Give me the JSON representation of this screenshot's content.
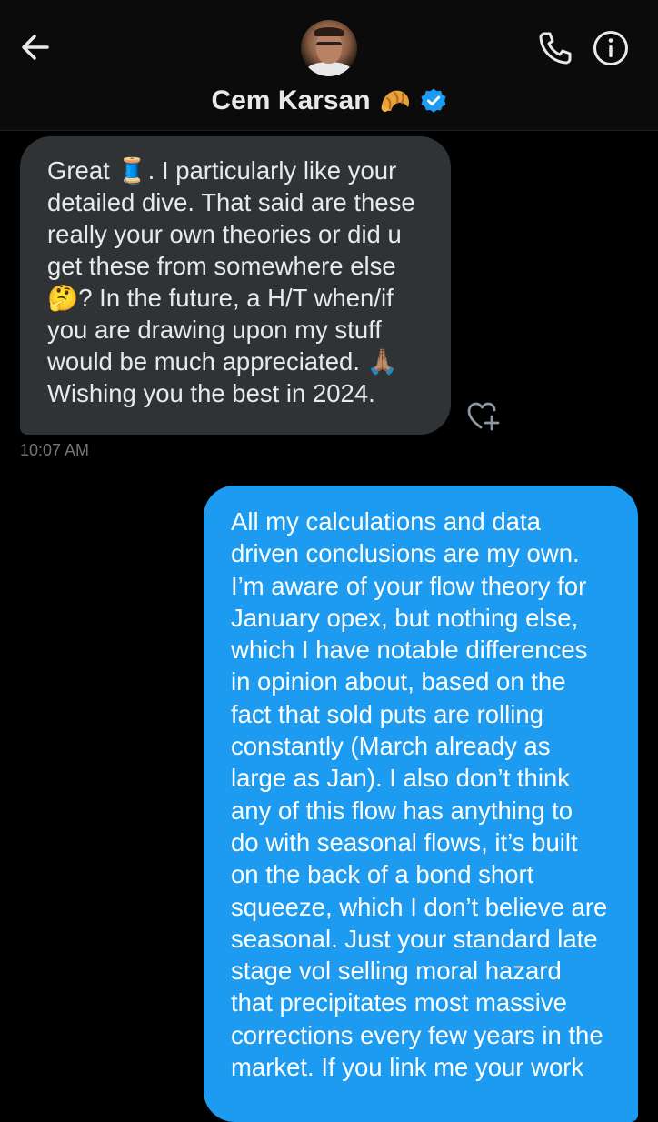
{
  "header": {
    "contact_name": "Cem Karsan",
    "name_emoji_icon": "croissant-icon",
    "verified_icon": "verified-badge-icon",
    "back_icon": "arrow-left-icon",
    "call_icon": "phone-icon",
    "info_icon": "info-icon",
    "accent_color": "#1d9bf0"
  },
  "messages": {
    "incoming": {
      "text": "Great 🧵. I particularly like your\ndetailed dive. That said are these\nreally your own theories or did u\nget these from somewhere else\n🤔? In the future, a  H/T when/if\nyou are drawing upon my stuff\nwould be much appreciated. 🙏🏽\nWishing you the best in 2024.",
      "timestamp": "10:07 AM",
      "bubble_color": "#2f3336",
      "reaction_icon": "add-reaction-heart-icon"
    },
    "outgoing": {
      "text": "All my calculations and data\ndriven conclusions are my own.\nI’m aware of your flow theory for\nJanuary opex, but nothing else,\nwhich I have notable differences\nin opinion about, based on the\nfact that sold puts are rolling\nconstantly (March already as\nlarge as Jan).  I also don’t think\nany of this flow has anything to\ndo with seasonal flows, it’s built\non the back of a bond short\nsqueeze, which I don’t believe are\nseasonal.  Just your standard late\nstage vol selling moral hazard\nthat precipitates most massive\ncorrections every few years in the\nmarket.  If you link me your work",
      "bubble_color": "#1d9bf0"
    }
  }
}
